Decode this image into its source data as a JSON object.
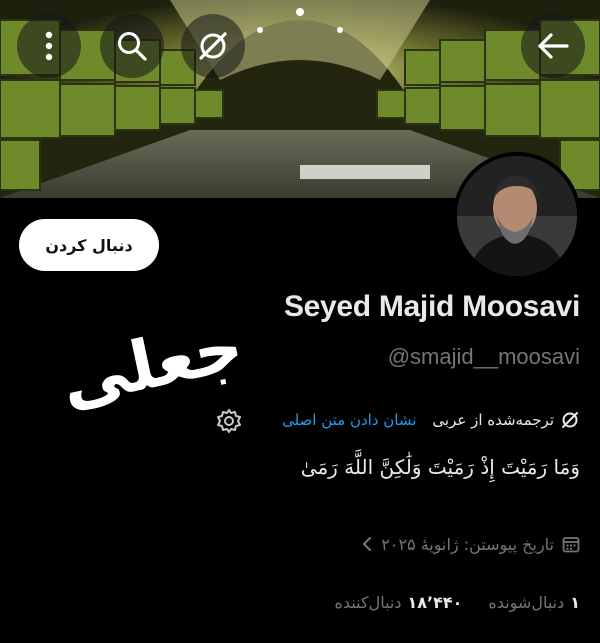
{
  "header": {
    "back_icon": "arrow-left-icon",
    "translate_icon": "translate-off-icon",
    "search_icon": "search-icon",
    "more_icon": "more-vertical-icon"
  },
  "profile": {
    "follow_label": "دنبال کردن",
    "display_name": "Seyed Majid Moosavi",
    "handle": "@smajid__moosavi",
    "overlay_word": "جعلی",
    "translation_note": "ترجمه‌شده از عربی",
    "show_original": "نشان دادن متن اصلی",
    "bio": "وَمَا رَمَيْتَ إِذْ رَمَيْتَ وَلَٰكِنَّ اللَّهَ رَمَىٰ",
    "joined": "تاریخ پیوستن: ژانویهٔ ۲۰۲۵",
    "following_count": "۱",
    "following_label": "دنبال‌شونده",
    "followers_count": "۱۸٬۴۴۰",
    "followers_label": "دنبال‌کننده"
  },
  "colors": {
    "background": "#000000",
    "text": "#e7e9ea",
    "muted": "#71767b",
    "link": "#1d9bf0"
  }
}
